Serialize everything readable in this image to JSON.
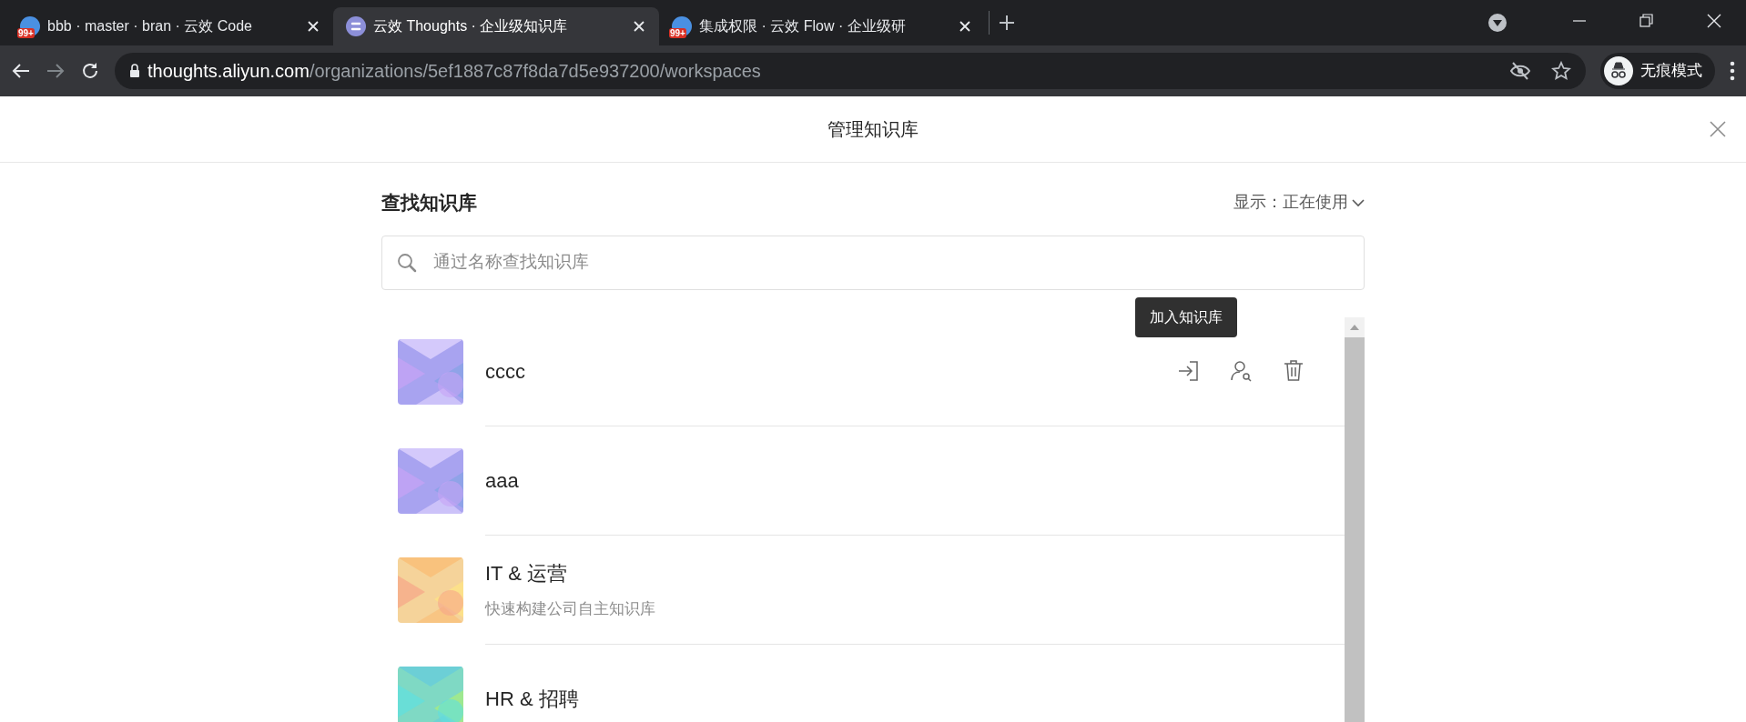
{
  "browser": {
    "tabs": [
      {
        "title": "bbb · master · bran · 云效 Code",
        "kind": "badge",
        "badge": "99+",
        "selected": false
      },
      {
        "title": "云效 Thoughts · 企业级知识库",
        "kind": "logo",
        "selected": true
      },
      {
        "title": "集成权限 · 云效 Flow · 企业级研",
        "kind": "badge",
        "badge": "99+",
        "selected": false
      }
    ],
    "address": {
      "host": "thoughts.aliyun.com",
      "path": "/organizations/5ef1887c87f8da7d5e937200/workspaces"
    },
    "profile": "无痕模式"
  },
  "dialog": {
    "title": "管理知识库",
    "heading": "查找知识库",
    "filter": {
      "label": "显示：",
      "value": "正在使用"
    },
    "search": {
      "placeholder": "通过名称查找知识库"
    },
    "tooltip": "加入知识库",
    "workspaces": [
      {
        "name": "cccc",
        "kind": "violet",
        "hovered": true
      },
      {
        "name": "aaa",
        "kind": "violet",
        "hovered": false
      },
      {
        "name": "IT & 运营",
        "description": "快速构建公司自主知识库",
        "kind": "warm",
        "hovered": false
      },
      {
        "name": "HR & 招聘",
        "kind": "mint",
        "hovered": false
      }
    ]
  }
}
